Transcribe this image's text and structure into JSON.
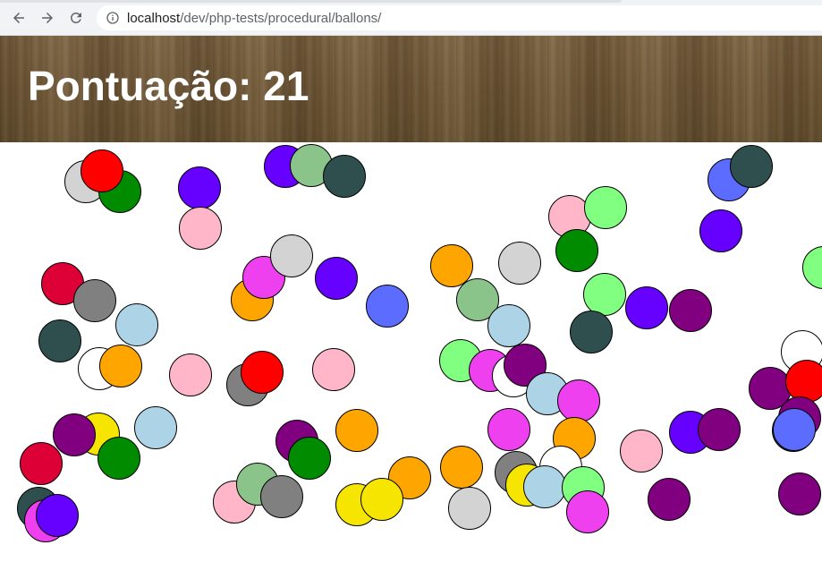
{
  "browser": {
    "url_host": "localhost",
    "url_path": "/dev/php-tests/procedural/ballons/",
    "icons": {
      "back": "arrow-left-icon",
      "forward": "arrow-right-icon",
      "reload": "reload-icon",
      "info": "info-icon"
    }
  },
  "header": {
    "score_label": "Pontuação:",
    "score_value": "21"
  },
  "colors": {
    "red": "#ff0000",
    "green": "#008b00",
    "lightgray": "#d3d3d3",
    "violet": "#6600ff",
    "pink": "#ffb6c8",
    "mediumgreen": "#8bc48b",
    "darkslate": "#2f4f4f",
    "royalblue": "#5c6cff",
    "lightgreen": "#80ff80",
    "crimson": "#dc0037",
    "gray": "#808080",
    "magenta": "#ee40ee",
    "orange": "#ffa500",
    "lightblue": "#add4e6",
    "purple": "#800080",
    "white": "#ffffff",
    "yellow": "#f5e500"
  },
  "balloons": [
    "lightgray",
    "green",
    "red",
    "violet",
    "pink",
    "violet",
    "mediumgreen",
    "darkslate",
    "royalblue",
    "darkslate",
    "violet",
    "pink",
    "lightgreen",
    "green",
    "crimson",
    "gray",
    "darkslate",
    "lightblue",
    "white",
    "orange",
    "pink",
    "orange",
    "magenta",
    "lightgray",
    "violet",
    "royalblue",
    "gray",
    "red",
    "pink",
    "orange",
    "lightgray",
    "mediumgreen",
    "lightblue",
    "lightgreen",
    "darkslate",
    "violet",
    "purple",
    "lightblue",
    "lightgreen",
    "magenta",
    "white",
    "purple",
    "lightblue",
    "magenta",
    "purple",
    "orange",
    "lightblue",
    "yellow",
    "purple",
    "crimson",
    "green",
    "magenta",
    "purple",
    "green",
    "orange",
    "orange",
    "orange",
    "gray",
    "yellow",
    "white",
    "darkslate",
    "pink",
    "violet",
    "purple",
    "white",
    "red",
    "purple",
    "royalblue",
    "darkslate",
    "magenta",
    "violet",
    "pink",
    "mediumgreen",
    "gray",
    "yellow",
    "yellow",
    "lightgray",
    "lightblue",
    "purple",
    "lightgreen",
    "magenta",
    "purple",
    "lightgreen",
    "lightblue"
  ]
}
